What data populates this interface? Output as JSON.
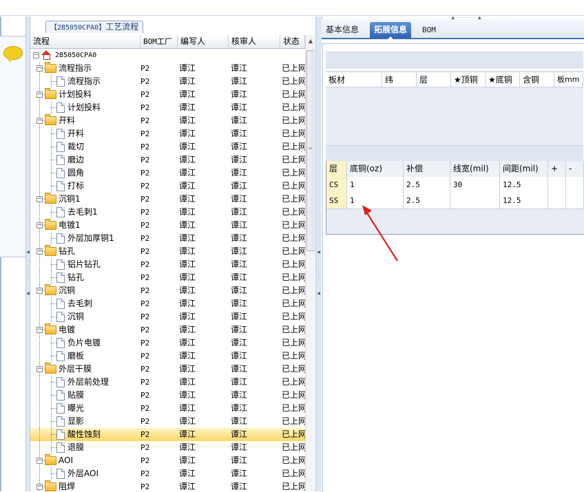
{
  "process_tab": {
    "code": "【2B5050CPA0】",
    "label": "工艺流程"
  },
  "tree": {
    "columns": [
      "流程",
      "BOM工厂",
      "编写人",
      "核审人",
      "状态"
    ],
    "rows": [
      {
        "level": 0,
        "type": "root",
        "expander": "−",
        "name": "2B5050CPA0",
        "bom": "",
        "author": "",
        "reviewer": "",
        "status": ""
      },
      {
        "level": 1,
        "type": "folder",
        "expander": "−",
        "name": "流程指示",
        "bom": "P2",
        "author": "谭江",
        "reviewer": "谭江",
        "status": "已上网"
      },
      {
        "level": 2,
        "type": "doc",
        "name": "流程指示",
        "bom": "P2",
        "author": "谭江",
        "reviewer": "谭江",
        "status": "已上网"
      },
      {
        "level": 1,
        "type": "folder",
        "expander": "−",
        "name": "计划投料",
        "bom": "P2",
        "author": "谭江",
        "reviewer": "谭江",
        "status": "已上网"
      },
      {
        "level": 2,
        "type": "doc",
        "name": "计划投料",
        "bom": "P2",
        "author": "谭江",
        "reviewer": "谭江",
        "status": "已上网"
      },
      {
        "level": 1,
        "type": "folder",
        "expander": "−",
        "name": "开料",
        "bom": "P2",
        "author": "谭江",
        "reviewer": "谭江",
        "status": "已上网"
      },
      {
        "level": 2,
        "type": "doc",
        "name": "开料",
        "bom": "P2",
        "author": "谭江",
        "reviewer": "谭江",
        "status": "已上网"
      },
      {
        "level": 2,
        "type": "doc",
        "name": "裁切",
        "bom": "P2",
        "author": "谭江",
        "reviewer": "谭江",
        "status": "已上网"
      },
      {
        "level": 2,
        "type": "doc",
        "name": "磨边",
        "bom": "P2",
        "author": "谭江",
        "reviewer": "谭江",
        "status": "已上网"
      },
      {
        "level": 2,
        "type": "doc",
        "name": "圆角",
        "bom": "P2",
        "author": "谭江",
        "reviewer": "谭江",
        "status": "已上网"
      },
      {
        "level": 2,
        "type": "doc",
        "name": "打标",
        "bom": "P2",
        "author": "谭江",
        "reviewer": "谭江",
        "status": "已上网"
      },
      {
        "level": 1,
        "type": "folder",
        "expander": "−",
        "name": "沉铜1",
        "bom": "P2",
        "author": "谭江",
        "reviewer": "谭江",
        "status": "已上网"
      },
      {
        "level": 2,
        "type": "doc",
        "name": "去毛刺1",
        "bom": "P2",
        "author": "谭江",
        "reviewer": "谭江",
        "status": "已上网"
      },
      {
        "level": 1,
        "type": "folder",
        "expander": "−",
        "name": "电镀1",
        "bom": "P2",
        "author": "谭江",
        "reviewer": "谭江",
        "status": "已上网"
      },
      {
        "level": 2,
        "type": "doc",
        "name": "外层加厚铜1",
        "bom": "P2",
        "author": "谭江",
        "reviewer": "谭江",
        "status": "已上网"
      },
      {
        "level": 1,
        "type": "folder",
        "expander": "−",
        "name": "钻孔",
        "bom": "P2",
        "author": "谭江",
        "reviewer": "谭江",
        "status": "已上网"
      },
      {
        "level": 2,
        "type": "doc",
        "name": "铝片钻孔",
        "bom": "P2",
        "author": "谭江",
        "reviewer": "谭江",
        "status": "已上网"
      },
      {
        "level": 2,
        "type": "doc",
        "name": "钻孔",
        "bom": "P2",
        "author": "谭江",
        "reviewer": "谭江",
        "status": "已上网"
      },
      {
        "level": 1,
        "type": "folder",
        "expander": "−",
        "name": "沉铜",
        "bom": "P2",
        "author": "谭江",
        "reviewer": "谭江",
        "status": "已上网"
      },
      {
        "level": 2,
        "type": "doc",
        "name": "去毛刺",
        "bom": "P2",
        "author": "谭江",
        "reviewer": "谭江",
        "status": "已上网"
      },
      {
        "level": 2,
        "type": "doc",
        "name": "沉铜",
        "bom": "P2",
        "author": "谭江",
        "reviewer": "谭江",
        "status": "已上网"
      },
      {
        "level": 1,
        "type": "folder",
        "expander": "−",
        "name": "电镀",
        "bom": "P2",
        "author": "谭江",
        "reviewer": "谭江",
        "status": "已上网"
      },
      {
        "level": 2,
        "type": "doc",
        "name": "负片电镀",
        "bom": "P2",
        "author": "谭江",
        "reviewer": "谭江",
        "status": "已上网"
      },
      {
        "level": 2,
        "type": "doc",
        "name": "磨板",
        "bom": "P2",
        "author": "谭江",
        "reviewer": "谭江",
        "status": "已上网"
      },
      {
        "level": 1,
        "type": "folder",
        "expander": "−",
        "name": "外层干膜",
        "bom": "P2",
        "author": "谭江",
        "reviewer": "谭江",
        "status": "已上网"
      },
      {
        "level": 2,
        "type": "doc",
        "name": "外层前处理",
        "bom": "P2",
        "author": "谭江",
        "reviewer": "谭江",
        "status": "已上网"
      },
      {
        "level": 2,
        "type": "doc",
        "name": "贴膜",
        "bom": "P2",
        "author": "谭江",
        "reviewer": "谭江",
        "status": "已上网"
      },
      {
        "level": 2,
        "type": "doc",
        "name": "曝光",
        "bom": "P2",
        "author": "谭江",
        "reviewer": "谭江",
        "status": "已上网"
      },
      {
        "level": 2,
        "type": "doc",
        "name": "显影",
        "bom": "P2",
        "author": "谭江",
        "reviewer": "谭江",
        "status": "已上网"
      },
      {
        "level": 2,
        "type": "doc",
        "name": "酸性蚀刻",
        "bom": "P2",
        "author": "谭江",
        "reviewer": "谭江",
        "status": "已上网",
        "selected": true
      },
      {
        "level": 2,
        "type": "doc",
        "name": "退膜",
        "bom": "P2",
        "author": "谭江",
        "reviewer": "谭江",
        "status": "已上网"
      },
      {
        "level": 1,
        "type": "folder",
        "expander": "−",
        "name": "AOI",
        "bom": "P2",
        "author": "谭江",
        "reviewer": "谭江",
        "status": "已上网"
      },
      {
        "level": 2,
        "type": "doc",
        "name": "外层AOI",
        "bom": "P2",
        "author": "谭江",
        "reviewer": "谭江",
        "status": "已上网"
      },
      {
        "level": 1,
        "type": "folder",
        "expander": "−",
        "name": "阻焊",
        "bom": "P2",
        "author": "谭江",
        "reviewer": "谭江",
        "status": "已上网"
      }
    ]
  },
  "right_tabs": [
    {
      "label": "基本信息",
      "active": false
    },
    {
      "label": "拓展信息",
      "active": true
    },
    {
      "label": "BOM",
      "active": false
    }
  ],
  "board_table": {
    "columns": [
      "板材",
      "纬",
      "层",
      "★顶铜",
      "★底铜",
      "含铜",
      "板mm"
    ]
  },
  "layer_table": {
    "columns": [
      "层",
      "底铜(oz)",
      "补偿",
      "线宽(mil)",
      "间距(mil)",
      "+",
      "-"
    ],
    "rows": [
      [
        "CS",
        "1",
        "2.5",
        "30",
        "12.5",
        "",
        ""
      ],
      [
        "SS",
        "1",
        "2.5",
        "",
        "12.5",
        "",
        ""
      ]
    ]
  },
  "colors": {
    "accent": "#2f64b4",
    "selection": "#fbd86a",
    "arrow": "#e02020"
  }
}
